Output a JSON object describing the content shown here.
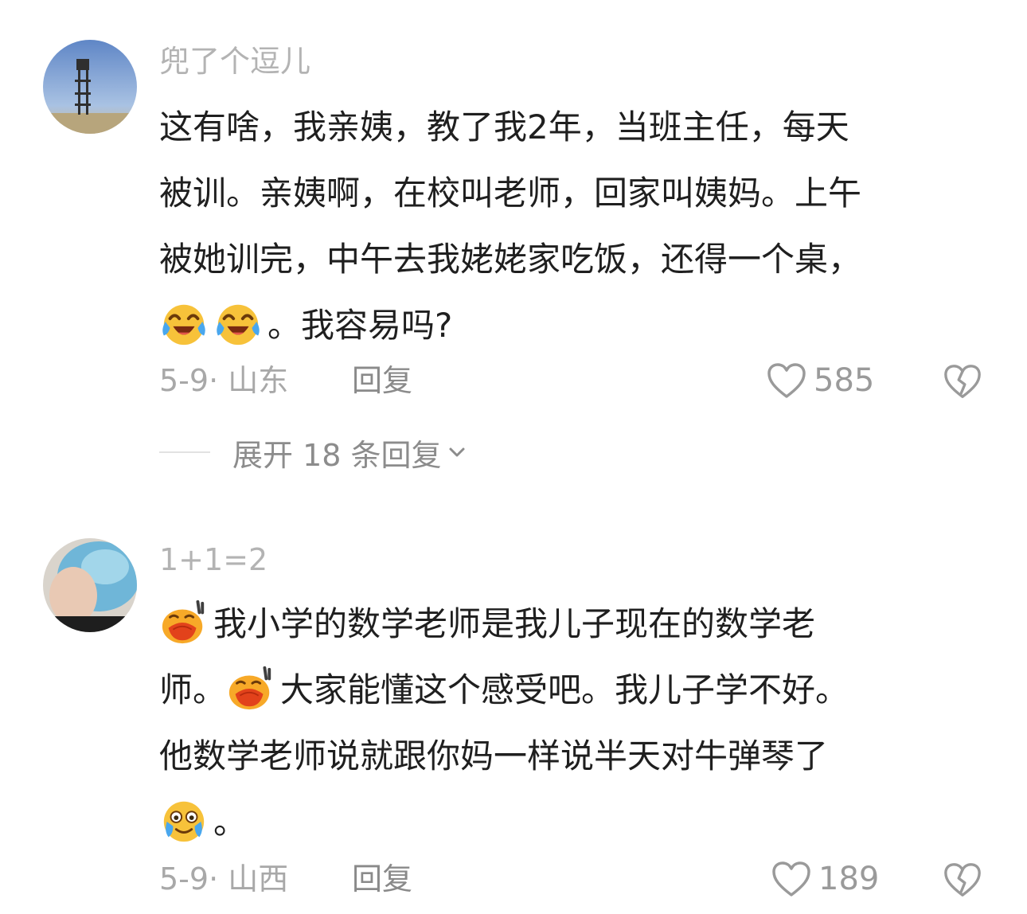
{
  "comments": [
    {
      "username": "兜了个逗儿",
      "avatar_icon": "watchtower-landscape-avatar",
      "lines": [
        {
          "text": "这有啥，我亲姨，教了我2年，当班主任，每天"
        },
        {
          "text": "被训。亲姨啊，在校叫老师，回家叫姨妈。上午"
        },
        {
          "text": "被她训完，中午去我姥姥家吃饭，还得一个桌，"
        },
        {
          "text": "。我容易吗?"
        }
      ],
      "emojis": [
        "laughing-crying-emoji",
        "laughing-crying-emoji"
      ],
      "date_location": "5-9· 山东",
      "reply_label": "回复",
      "like_count": "585",
      "expand_label": "展开 18 条回复"
    },
    {
      "username": "1+1=2",
      "avatar_icon": "blue-hair-portrait-avatar",
      "lines": [
        {
          "text": "我小学的数学老师是我儿子现在的数学老"
        },
        {
          "text": "师。",
          "after": "大家能懂这个感受吧。我儿子学不好。"
        },
        {
          "text": "他数学老师说就跟你妈一样说半天对牛弹琴了"
        },
        {
          "text": "。"
        }
      ],
      "emojis": [
        "sweating-smile-emoji",
        "sweating-smile-emoji",
        "crying-grin-emoji"
      ],
      "date_location": "5-9· 山西",
      "reply_label": "回复",
      "like_count": "189"
    }
  ],
  "icons": {
    "like": "heart-outline-icon",
    "dislike": "broken-heart-icon",
    "expand": "chevron-down-icon"
  },
  "colors": {
    "username": "#b3b3b3",
    "body": "#1f1f1f",
    "meta": "#a8a8a8",
    "reply": "#8a8a8a",
    "like_count": "#9a9a9a"
  }
}
